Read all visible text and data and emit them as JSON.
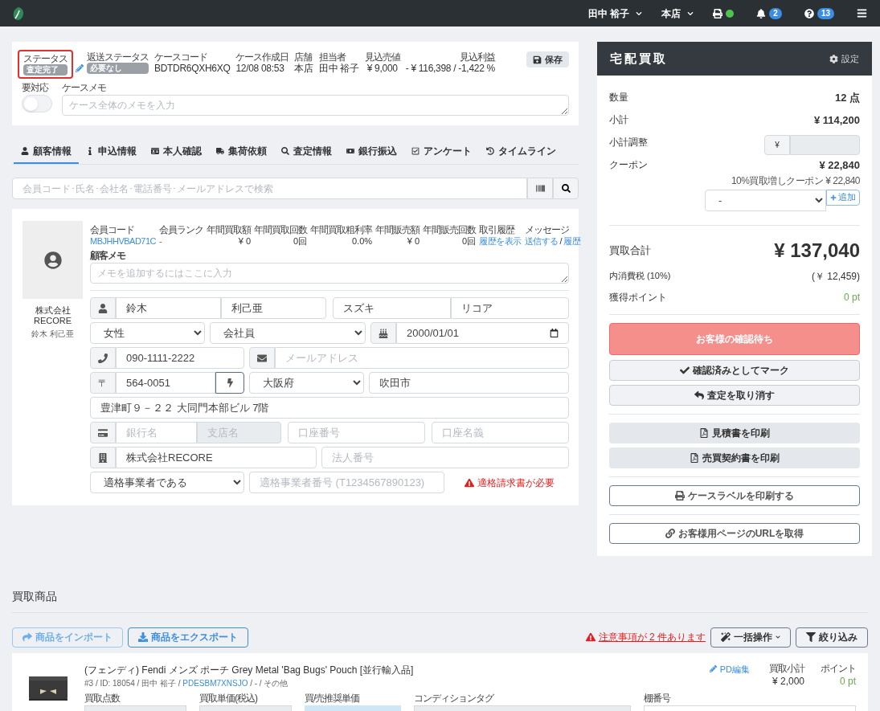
{
  "navbar": {
    "user": "田中 裕子",
    "store": "本店",
    "printer_online": true,
    "notifications": "2",
    "help": "13"
  },
  "case_header": {
    "status_label": "ステータス",
    "status": "査定完了",
    "status_highlighted": true,
    "return_label": "返送ステータス",
    "return_status": "必要なし",
    "code_label": "ケースコード",
    "code": "BDTDR6QXH6XQ",
    "date_label": "ケース作成日",
    "date": "12/08 08:53",
    "store_label": "店舗",
    "store": "本店",
    "staff_label": "担当者",
    "staff": "田中 裕子",
    "price_label": "見込売値",
    "price": "¥ 9,000",
    "profit_label": "見込利益",
    "profit": "- ¥ 116,398 / -1,422 %",
    "save": "保存",
    "attention_label": "要対応",
    "attention_on": false,
    "memo_label": "ケースメモ",
    "memo_placeholder": "ケース全体のメモを入力"
  },
  "tabs": [
    {
      "label": "顧客情報",
      "selected": true
    },
    {
      "label": "申込情報",
      "selected": false
    },
    {
      "label": "本人確認",
      "selected": false
    },
    {
      "label": "集荷依頼",
      "selected": false
    },
    {
      "label": "査定情報",
      "selected": false
    },
    {
      "label": "銀行振込",
      "selected": false
    },
    {
      "label": "アンケート",
      "selected": false
    },
    {
      "label": "タイムライン",
      "selected": false
    }
  ],
  "search": {
    "placeholder": "会員コード･氏名･会社名･電話番号･メールアドレスで検索"
  },
  "customer": {
    "company": "株式会社 RECORE",
    "name": "鈴木 利己亜",
    "stats": [
      {
        "label": "会員コード",
        "value": "MBJHHVBAD71C",
        "kind": "link"
      },
      {
        "label": "会員ランク",
        "value": "-",
        "kind": "alert"
      },
      {
        "label": "年間買取額",
        "value": "¥ 0",
        "kind": "number"
      },
      {
        "label": "年間買取回数",
        "value": "0回",
        "kind": "number"
      },
      {
        "label": "年間買取粗利率",
        "value": "0.0%",
        "kind": "number"
      },
      {
        "label": "年間販売額",
        "value": "¥ 0",
        "kind": "number"
      },
      {
        "label": "年間販売回数",
        "value": "0回",
        "kind": "number"
      },
      {
        "label": "取引履歴",
        "value": "履歴を表示",
        "kind": "link"
      }
    ],
    "message_label": "メッセージ",
    "message_send": "送信する",
    "message_sep": "/",
    "message_history": "履歴",
    "memo_label": "顧客メモ",
    "memo_placeholder": "メモを追加するにはここに入力",
    "last_name": "鈴木",
    "first_name": "利己亜",
    "last_kana": "スズキ",
    "first_kana": "リコア",
    "gender": "女性",
    "occupation": "会社員",
    "birthday": "2000/01/01",
    "phone": "090-1111-2222",
    "email_placeholder": "メールアドレス",
    "zip_mark": "〒",
    "zip": "564-0051",
    "prefecture": "大阪府",
    "city": "吹田市",
    "address": "豊津町９－２２ 大同門本部ビル 7階",
    "bank_placeholder": "銀行名",
    "branch_placeholder": "支店名",
    "account_placeholder": "口座番号",
    "holder_placeholder": "口座名義",
    "corp_name": "株式会社RECORE",
    "corp_number_placeholder": "法人番号",
    "invoice_status": "適格事業者である",
    "invoice_placeholder": "適格事業者番号 (T1234567890123)",
    "invoice_warning": "適格請求書が必要"
  },
  "summary": {
    "title": "宅配買取",
    "settings": "設定",
    "rows": [
      {
        "label": "数量",
        "value": "12 点"
      },
      {
        "label": "小計",
        "value": "¥ 114,200"
      }
    ],
    "adjust_label": "小計調整",
    "adjust_prefix": "¥",
    "coupon_label": "クーポン",
    "coupon_value": "¥ 22,840",
    "coupon_detail": "10%買取増しクーポン ¥ 22,840",
    "coupon_select": "-",
    "coupon_add": "追加",
    "total_label": "買取合計",
    "total": "¥ 137,040",
    "tax_label": "内消費税 (10%)",
    "tax": "(￥ 12,459)",
    "points_label": "獲得ポイント",
    "points": "0 pt",
    "waiting": "お客様の確認待ち",
    "mark_confirmed": "確認済みとしてマーク",
    "cancel": "査定を取り消す",
    "print_estimate": "見積書を印刷",
    "print_contract": "売買契約書を印刷",
    "print_label": "ケースラベルを印刷する",
    "get_url": "お客様用ページのURLを取得"
  },
  "items": {
    "title": "買取商品",
    "import": "商品をインポート",
    "export": "商品をエクスポート",
    "warning": "注意事項が 2 件あります",
    "bulk": "一括操作",
    "filter": "絞り込み",
    "rows": [
      {
        "kind": "picture",
        "name": "(フェンディ) Fendi メンズ ポーチ Grey Metal 'Bag Bugs' Pouch [並行輸入品]",
        "meta": "#3 / ID: 18054 / 田中 裕子 / ",
        "code": "PDESBM7XNSJO",
        "meta_tail": " / - / その他",
        "edit": "PD編集",
        "subtotal_label": "買取小計",
        "subtotal": "¥ 2,000",
        "points_label": "ポイント",
        "points": "0 pt",
        "qty_label": "買取点数",
        "price_label": "買取単価(税込)",
        "rec_label": "買/売推奨単価",
        "cond_label": "コンディションタグ",
        "shelf_label": "棚番号"
      }
    ]
  }
}
